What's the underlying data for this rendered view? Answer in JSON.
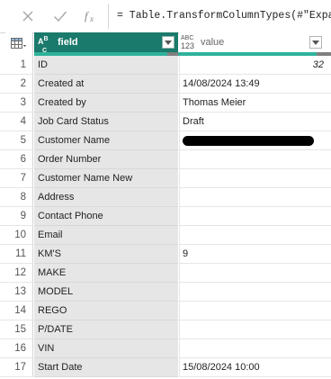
{
  "formula_bar": {
    "formula": "= Table.TransformColumnTypes(#\"Expan"
  },
  "columns": [
    {
      "type_top": "A",
      "type_sup": "B",
      "type_sub": "C",
      "name": "field"
    },
    {
      "type_top": "ABC",
      "type_sub": "123",
      "name": "value"
    }
  ],
  "rows": [
    {
      "n": "1",
      "field": "ID",
      "value": "32"
    },
    {
      "n": "2",
      "field": "Created at",
      "value": "14/08/2024 13:49"
    },
    {
      "n": "3",
      "field": "Created by",
      "value": "Thomas Meier"
    },
    {
      "n": "4",
      "field": "Job Card Status",
      "value": "Draft"
    },
    {
      "n": "5",
      "field": "Customer Name",
      "value": ""
    },
    {
      "n": "6",
      "field": "Order Number",
      "value": ""
    },
    {
      "n": "7",
      "field": "Customer Name New",
      "value": ""
    },
    {
      "n": "8",
      "field": "Address",
      "value": ""
    },
    {
      "n": "9",
      "field": "Contact Phone",
      "value": ""
    },
    {
      "n": "10",
      "field": "Email",
      "value": ""
    },
    {
      "n": "11",
      "field": "KM'S",
      "value": "9"
    },
    {
      "n": "12",
      "field": "MAKE",
      "value": ""
    },
    {
      "n": "13",
      "field": "MODEL",
      "value": ""
    },
    {
      "n": "14",
      "field": "REGO",
      "value": ""
    },
    {
      "n": "15",
      "field": "P/DATE",
      "value": ""
    },
    {
      "n": "16",
      "field": "VIN",
      "value": ""
    },
    {
      "n": "17",
      "field": "Start Date",
      "value": "15/08/2024 10:00"
    }
  ]
}
